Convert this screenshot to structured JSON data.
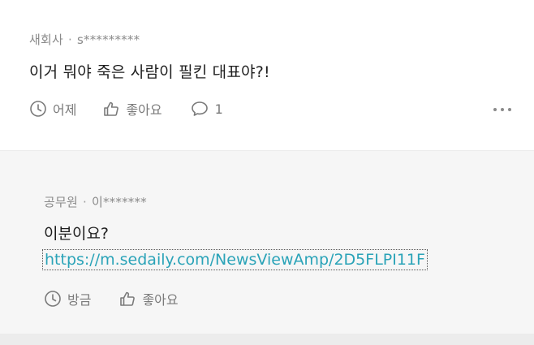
{
  "comment": {
    "author": "새회사",
    "separator": "·",
    "user_id": "s*********",
    "text": "이거 뭐야 죽은 사람이 필킨 대표야?!",
    "time": "어제",
    "like_label": "좋아요",
    "reply_count": "1"
  },
  "reply": {
    "author": "공무원",
    "separator": "·",
    "user_id": "이*******",
    "text": "이분이요?",
    "link": "https://m.sedaily.com/NewsViewAmp/2D5FLPI11F",
    "time": "방금",
    "like_label": "좋아요"
  },
  "colors": {
    "meta_text": "#8a8a8a",
    "body_text": "#1e1e1e",
    "link": "#2aa3b8",
    "reply_background": "#f6f6f6"
  }
}
